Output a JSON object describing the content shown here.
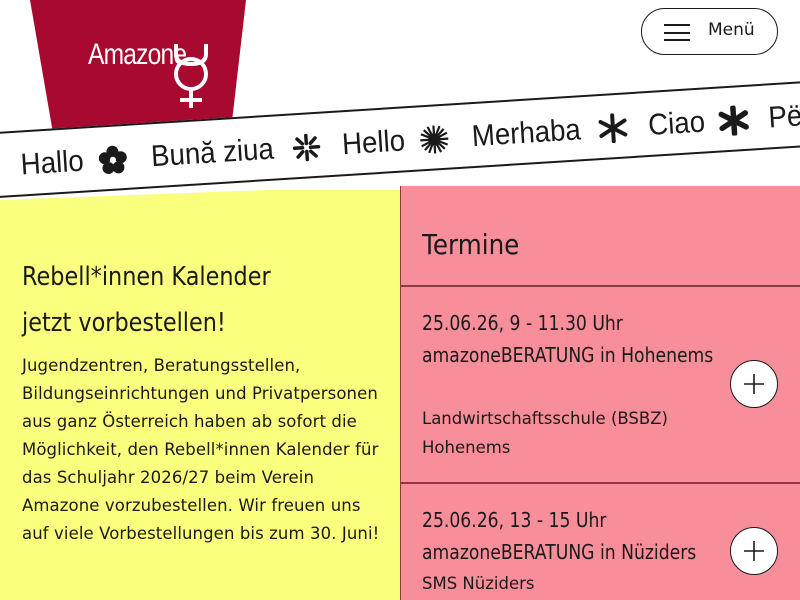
{
  "header": {
    "logo_text": "Amazone",
    "menu_label": "Menü",
    "brand_color": "#a8092f"
  },
  "ticker": {
    "words": [
      "Hallo",
      "Bună ziua",
      "Hello",
      "Merhaba",
      "Ciao",
      "Për"
    ],
    "separator_icons": [
      "flower-icon",
      "star-burst-icon",
      "sun-icon",
      "asterisk-icon",
      "asterisk-bold-icon"
    ]
  },
  "promo": {
    "title_line1": "Rebell*innen Kalender",
    "title_line2": "jetzt vorbestellen!",
    "body": "Jugendzentren, Beratungsstellen, Bildungseinrichtungen und Privatpersonen aus ganz Österreich haben ab sofort die Möglichkeit, den Rebell*innen Kalender für das Schuljahr 2026/27 beim Verein Amazone vorzubestellen. Wir freuen uns auf viele Vorbestellungen bis zum 30. Juni!",
    "background": "#faff7d"
  },
  "events": {
    "title": "Termine",
    "background": "#f88e9a",
    "items": [
      {
        "date_time": "25.06.26, 9 - 11.30 Uhr",
        "name": "amazoneBERATUNG in Hohenems",
        "location": "Landwirtschaftsschule (BSBZ) Hohenems"
      },
      {
        "date_time": "25.06.26, 13 - 15 Uhr",
        "name": "amazoneBERATUNG in Nüziders",
        "location": "SMS Nüziders"
      }
    ]
  }
}
